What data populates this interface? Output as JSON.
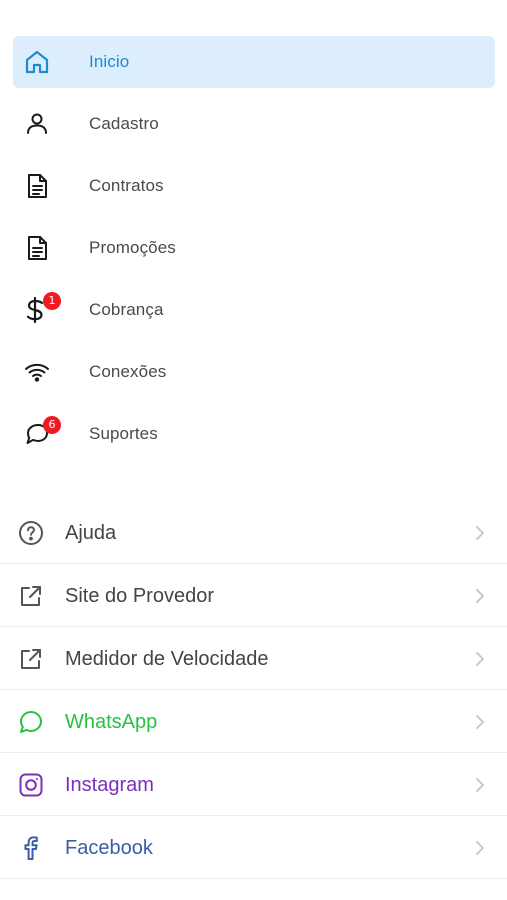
{
  "colors": {
    "active_bg": "#dceefd",
    "active_text": "#1e8ad0",
    "text": "#4a4a4a",
    "badge": "#f01a24",
    "whatsapp": "#25c244",
    "instagram": "#7a2fc0",
    "facebook": "#3b5da8"
  },
  "menu": [
    {
      "label": "Inicio",
      "icon": "home-icon",
      "active": true
    },
    {
      "label": "Cadastro",
      "icon": "user-icon"
    },
    {
      "label": "Contratos",
      "icon": "document-icon"
    },
    {
      "label": "Promoções",
      "icon": "document-icon"
    },
    {
      "label": "Cobrança",
      "icon": "dollar-icon",
      "badge": "1"
    },
    {
      "label": "Conexões",
      "icon": "wifi-icon"
    },
    {
      "label": "Suportes",
      "icon": "chat-icon",
      "badge": "6"
    }
  ],
  "links": [
    {
      "label": "Ajuda",
      "icon": "help-circle-icon",
      "color": "#444444"
    },
    {
      "label": "Site do Provedor",
      "icon": "external-link-icon",
      "color": "#444444"
    },
    {
      "label": "Medidor de Velocidade",
      "icon": "external-link-icon",
      "color": "#444444"
    },
    {
      "label": "WhatsApp",
      "icon": "whatsapp-icon",
      "color": "#25c244"
    },
    {
      "label": "Instagram",
      "icon": "instagram-icon",
      "color": "#7a2fc0"
    },
    {
      "label": "Facebook",
      "icon": "facebook-icon",
      "color": "#3b5da8"
    }
  ]
}
